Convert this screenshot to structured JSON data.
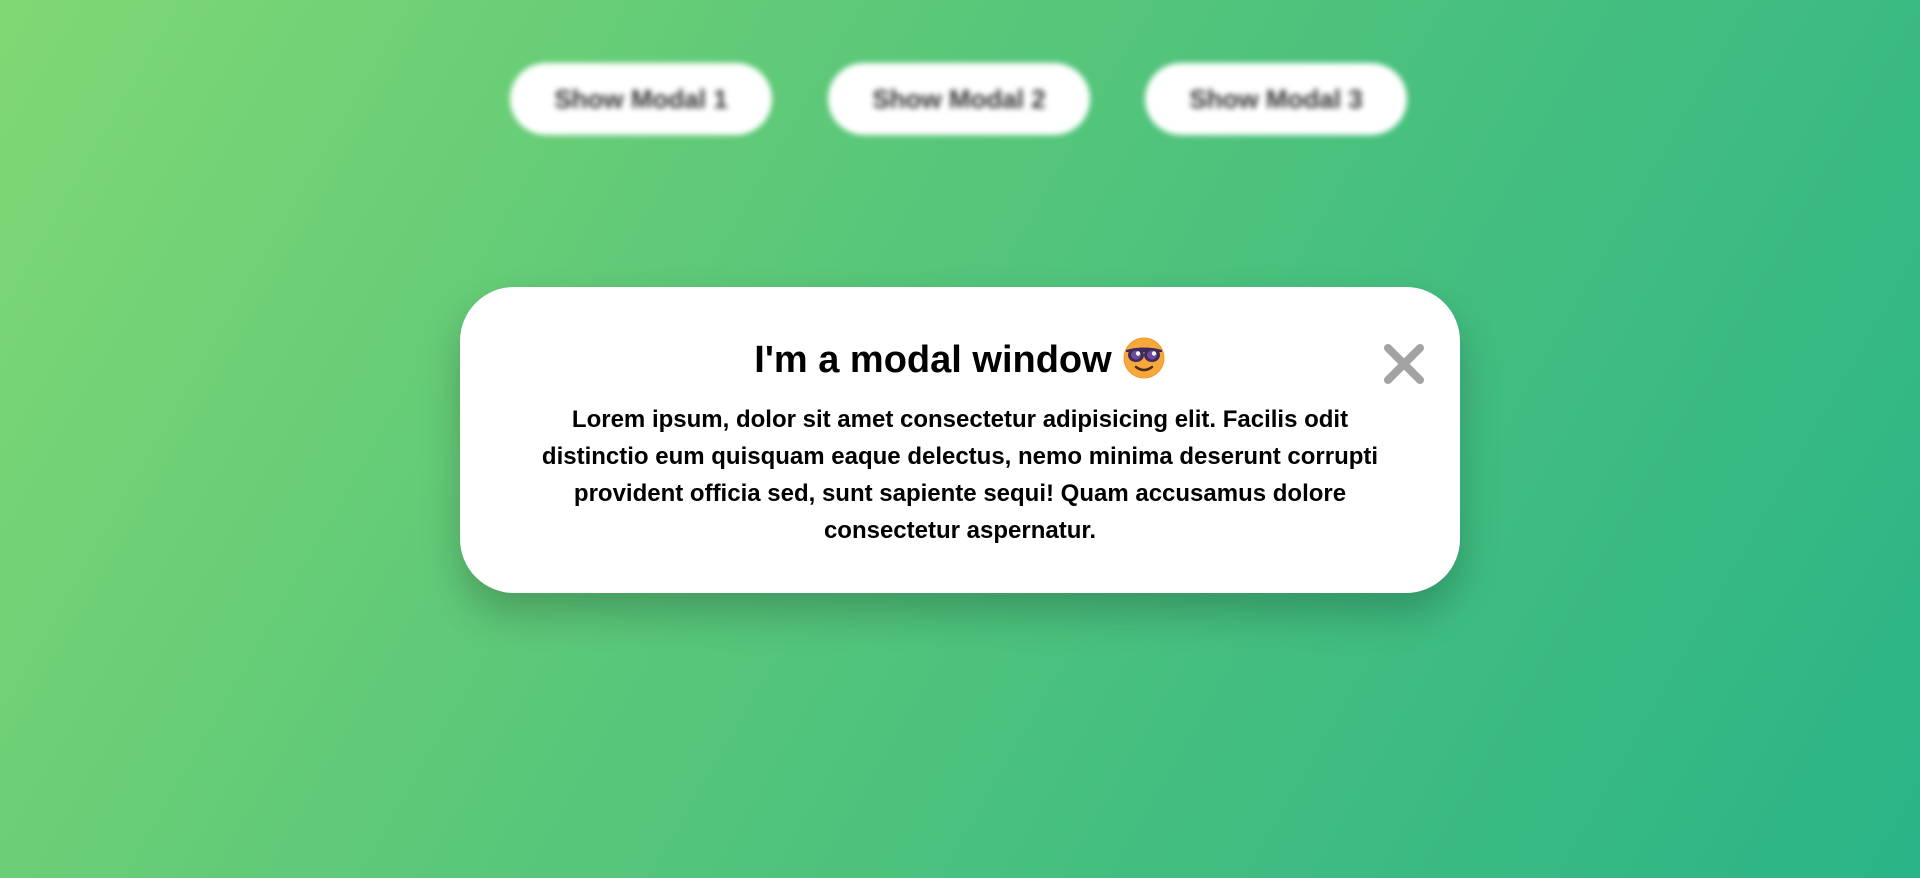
{
  "page": {
    "background_gradient": [
      "#80d874",
      "#2ab487"
    ]
  },
  "toolbar": {
    "buttons": [
      {
        "label": "Show Modal 1"
      },
      {
        "label": "Show Modal 2"
      },
      {
        "label": "Show Modal 3"
      }
    ]
  },
  "modal": {
    "title": "I'm a modal window",
    "title_icon": "smiling-face-with-sunglasses-icon",
    "body": "Lorem ipsum, dolor sit amet consectetur adipisicing elit. Facilis odit distinctio eum quisquam eaque delectus, nemo minima deserunt corrupti provident officia sed, sunt sapiente sequi! Quam accusamus dolore consectetur aspernatur.",
    "close_icon": "close-icon",
    "close_color": "#a3a3a3"
  }
}
